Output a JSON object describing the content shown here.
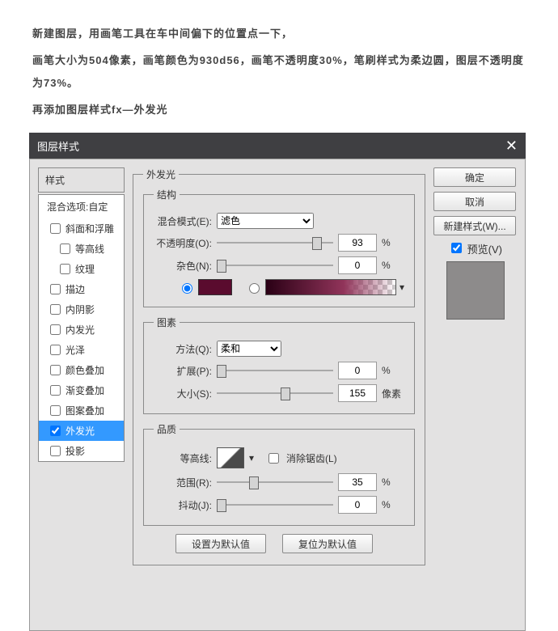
{
  "intro": {
    "line1": "新建图层，用画笔工具在车中间偏下的位置点一下，",
    "line2": "画笔大小为504像素，画笔颜色为930d56，画笔不透明度30%，笔刷样式为柔边圆，图层不透明度为73%。",
    "line3": "再添加图层样式fx—外发光"
  },
  "dialog": {
    "title": "图层样式",
    "close": "✕",
    "left": {
      "stylesHeader": "样式",
      "blendHeader": "混合选项:自定",
      "items": [
        {
          "label": "斜面和浮雕",
          "checked": false,
          "indent": false
        },
        {
          "label": "等高线",
          "checked": false,
          "indent": true
        },
        {
          "label": "纹理",
          "checked": false,
          "indent": true
        },
        {
          "label": "描边",
          "checked": false,
          "indent": false
        },
        {
          "label": "内阴影",
          "checked": false,
          "indent": false
        },
        {
          "label": "内发光",
          "checked": false,
          "indent": false
        },
        {
          "label": "光泽",
          "checked": false,
          "indent": false
        },
        {
          "label": "颜色叠加",
          "checked": false,
          "indent": false
        },
        {
          "label": "渐变叠加",
          "checked": false,
          "indent": false
        },
        {
          "label": "图案叠加",
          "checked": false,
          "indent": false
        },
        {
          "label": "外发光",
          "checked": true,
          "indent": false,
          "selected": true
        },
        {
          "label": "投影",
          "checked": false,
          "indent": false
        }
      ]
    },
    "center": {
      "group1": "外发光",
      "struct": {
        "legend": "结构",
        "blendModeLabel": "混合模式(E):",
        "blendModeValue": "滤色",
        "opacityLabel": "不透明度(O):",
        "opacityValue": "93",
        "opacityUnit": "%",
        "noiseLabel": "杂色(N):",
        "noiseValue": "0",
        "noiseUnit": "%",
        "swatchColor": "#5a0b2e"
      },
      "elem": {
        "legend": "图素",
        "methodLabel": "方法(Q):",
        "methodValue": "柔和",
        "spreadLabel": "扩展(P):",
        "spreadValue": "0",
        "spreadUnit": "%",
        "sizeLabel": "大小(S):",
        "sizeValue": "155",
        "sizeUnit": "像素"
      },
      "qual": {
        "legend": "品质",
        "contourLabel": "等高线:",
        "antiAliasLabel": "消除锯齿(L)",
        "rangeLabel": "范围(R):",
        "rangeValue": "35",
        "rangeUnit": "%",
        "jitterLabel": "抖动(J):",
        "jitterValue": "0",
        "jitterUnit": "%"
      },
      "defaultsBtn": "设置为默认值",
      "resetBtn": "复位为默认值"
    },
    "right": {
      "ok": "确定",
      "cancel": "取消",
      "newStyle": "新建样式(W)...",
      "previewLabel": "预览(V)"
    }
  }
}
